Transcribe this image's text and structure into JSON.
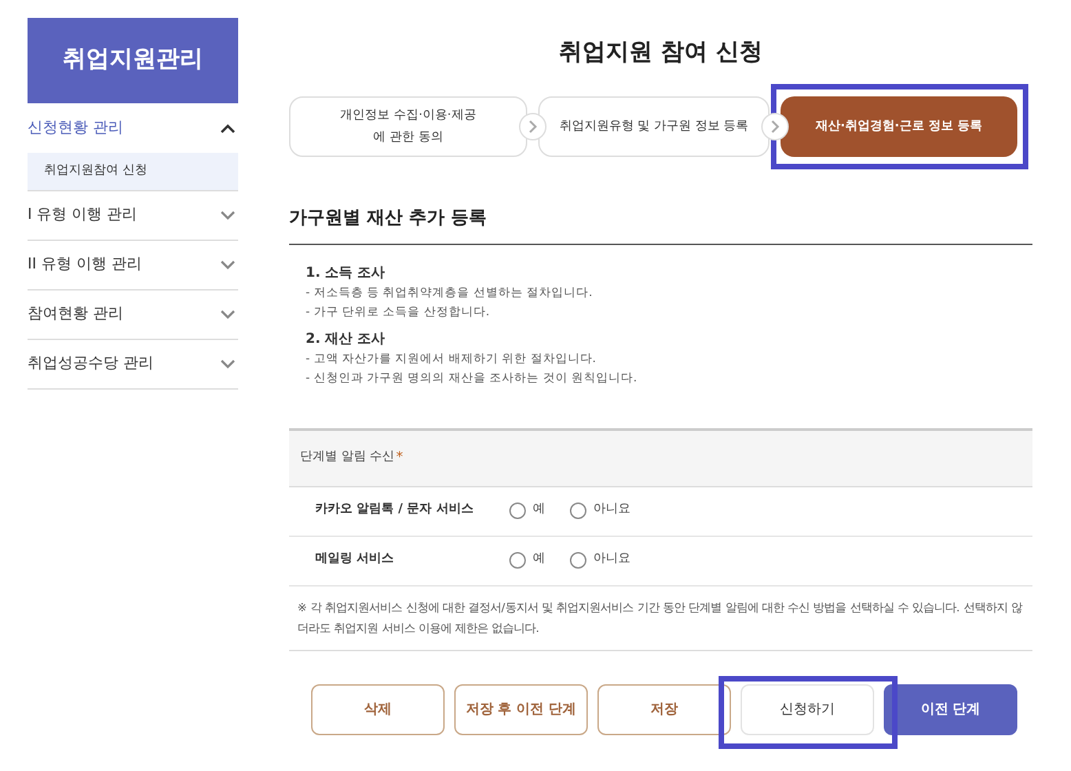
{
  "sidebar": {
    "title": "취업지원관리",
    "items": [
      {
        "label": "신청현황 관리",
        "expanded": true,
        "children": [
          {
            "label": "취업지원참여 신청",
            "selected": true
          }
        ]
      },
      {
        "label": "I 유형 이행 관리",
        "expanded": false
      },
      {
        "label": "II 유형 이행 관리",
        "expanded": false
      },
      {
        "label": "참여현황 관리",
        "expanded": false
      },
      {
        "label": "취업성공수당 관리",
        "expanded": false
      }
    ]
  },
  "page_title": "취업지원 참여 신청",
  "steps": [
    {
      "label": "개인정보 수집·이용·제공\n에 관한 동의",
      "selected": false,
      "highlighted": false
    },
    {
      "label": "취업지원유형 및 가구원 정보 등록",
      "selected": false,
      "highlighted": false
    },
    {
      "label": "재산·취업경험·근로 정보 등록",
      "selected": true,
      "highlighted": true
    }
  ],
  "section_title": "가구원별 재산 추가 등록",
  "info": [
    {
      "heading": "1. 소득 조사",
      "lines": [
        "- 저소득층 등 취업취약계층을 선별하는 절차입니다.",
        "- 가구 단위로 소득을 산정합니다."
      ]
    },
    {
      "heading": "2. 재산 조사",
      "lines": [
        "- 고액 자산가를 지원에서 배제하기 위한 절차입니다.",
        "- 신청인과 가구원 명의의 재산을 조사하는 것이 원칙입니다."
      ]
    }
  ],
  "notification": {
    "label": "단계별 알림 수신",
    "required_mark": "*",
    "rows": [
      {
        "label": "카카오 알림톡 / 문자 서비스",
        "options": [
          {
            "label": "예",
            "selected": false
          },
          {
            "label": "아니요",
            "selected": false
          }
        ]
      },
      {
        "label": "메일링 서비스",
        "options": [
          {
            "label": "예",
            "selected": false
          },
          {
            "label": "아니요",
            "selected": false
          }
        ]
      }
    ],
    "note": "※ 각 취업지원서비스 신청에 대한 결정서/동지서 및 취업지원서비스 기간 동안 단계별 알림에 대한 수신 방법을 선택하실 수 있습니다. 선택하지 않더라도 취업지원 서비스 이용에 제한은 없습니다."
  },
  "buttons": [
    {
      "label": "삭제",
      "kind": "outline",
      "highlighted": false
    },
    {
      "label": "저장 후 이전 단계",
      "kind": "outline",
      "highlighted": false
    },
    {
      "label": "저장",
      "kind": "outline",
      "highlighted": false
    },
    {
      "label": "신청하기",
      "kind": "plain",
      "highlighted": true
    },
    {
      "label": "이전 단계",
      "kind": "primary",
      "highlighted": false
    }
  ]
}
